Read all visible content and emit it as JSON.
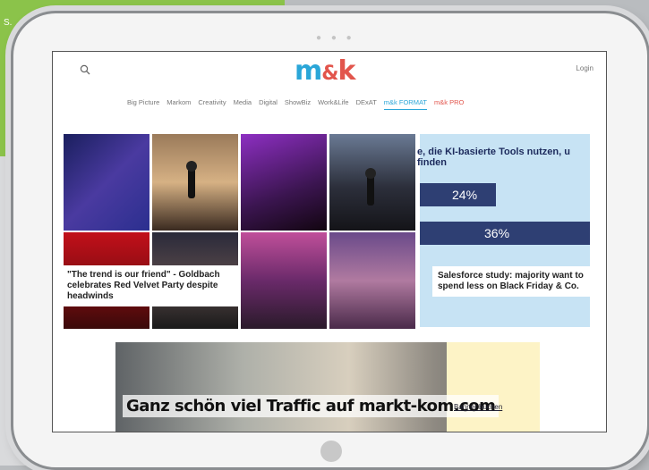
{
  "background_card": {
    "title": "",
    "sub": "S."
  },
  "tablet": {
    "dots": "● ● ●"
  },
  "header": {
    "logo_m": "m",
    "logo_amp": "&",
    "logo_k": "k",
    "login": "Login"
  },
  "nav": [
    "Big Picture",
    "Markom",
    "Creativity",
    "Media",
    "Digital",
    "ShowBiz",
    "Work&Life",
    "DExAT",
    "m&k FORMAT",
    "m&k PRO"
  ],
  "articles": [
    {
      "caption": "\"The trend is our friend\" - Goldbach celebrates Red Velvet Party despite headwinds"
    },
    {
      "caption": "Salesforce study: majority want to spend less on Black Friday & Co."
    }
  ],
  "chart": {
    "title": "e, die KI-basierte Tools nutzen, u finden",
    "bars": [
      {
        "label": "24%",
        "value": 24
      },
      {
        "label": "36%",
        "value": 36
      }
    ]
  },
  "banner": {
    "headline": "Ganz schön viel Traffic auf markt-kom.com",
    "cta": "Banner buchen"
  },
  "colors": {
    "accent_blue": "#2aa6d8",
    "accent_red": "#e2554c",
    "bar_navy": "#2e3f73",
    "chart_bg": "#c7e3f4"
  }
}
